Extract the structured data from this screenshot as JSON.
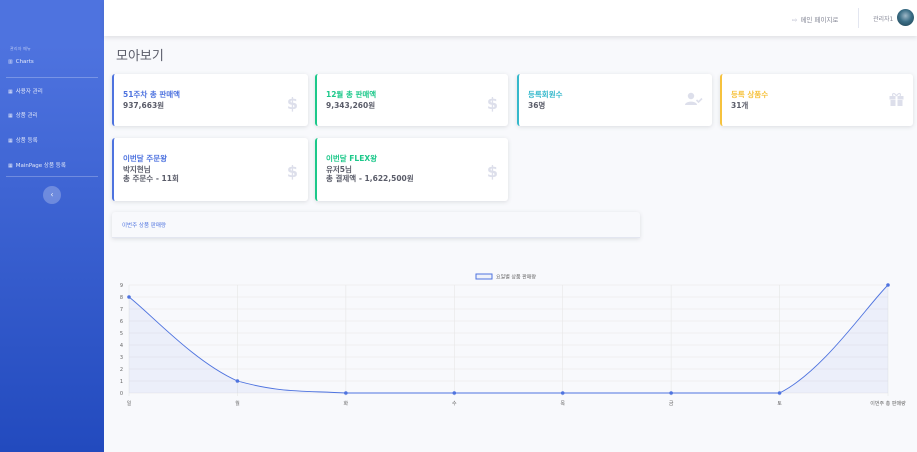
{
  "sidebar": {
    "heading": "관리자 메뉴",
    "items": [
      {
        "icon": "chart-icon",
        "label": "Charts"
      },
      {
        "icon": "table-icon",
        "label": "사용자 관리"
      },
      {
        "icon": "table-icon",
        "label": "상품 관리"
      },
      {
        "icon": "table-icon",
        "label": "상품 등록"
      },
      {
        "icon": "table-icon",
        "label": "MainPage 상품 등록"
      }
    ],
    "toggle_glyph": "‹"
  },
  "topbar": {
    "main_page_link": "메인 페이지로",
    "user_name": "관리자1"
  },
  "page_title": "모아보기",
  "cards": [
    {
      "label": "51주차 총 판매액",
      "value": "937,663원",
      "icon": "dollar-icon",
      "glyph": "$",
      "accent": "#4e73df"
    },
    {
      "label": "12월 총 판매액",
      "value": "9,343,260원",
      "icon": "dollar-icon",
      "glyph": "$",
      "accent": "#1cc88a"
    },
    {
      "label": "등록회원수",
      "value": "36명",
      "icon": "user-check-icon",
      "glyph": "",
      "accent": "#36b9cc"
    },
    {
      "label": "등록 상품수",
      "value": "31개",
      "icon": "gift-icon",
      "glyph": "",
      "accent": "#f6c23e"
    },
    {
      "label": "이번달 주문왕",
      "value": "박지현님\n총 주문수 - 11회",
      "icon": "dollar-icon",
      "glyph": "$",
      "accent": "#4e73df"
    },
    {
      "label": "이번달 FLEX왕",
      "value": "유저5님\n총 결제액 - 1,622,500원",
      "icon": "dollar-icon",
      "glyph": "$",
      "accent": "#1cc88a"
    }
  ],
  "section_title": "이번주 상품 판매량",
  "chart_data": {
    "type": "line",
    "series": [
      {
        "name": "요일별 상품 판매량",
        "values": [
          8,
          1,
          0,
          0,
          0,
          0,
          0,
          9
        ]
      }
    ],
    "categories": [
      "일",
      "월",
      "화",
      "수",
      "목",
      "금",
      "토",
      "이번주 총 판매량"
    ],
    "ylim": [
      0,
      9
    ],
    "yticks": [
      0,
      1,
      2,
      3,
      4,
      5,
      6,
      7,
      8,
      9
    ],
    "grid": true,
    "legend": "top",
    "color": "#4e73df"
  }
}
